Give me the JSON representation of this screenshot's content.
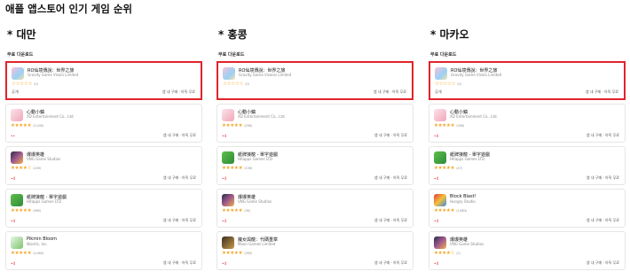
{
  "page_title": "애플 앱스토어 인기 게임 순위",
  "columns": [
    {
      "region": "* 대만",
      "section": "무료 다운로드",
      "apps": [
        {
          "name": "RO仙境傳說：世界之旅",
          "developer": "Gravity Game Vision Limited",
          "stars": 0,
          "rating_count": "(0)",
          "price": "공개",
          "iap": "앱 내 구매 · 아직 무료",
          "icon": "ro-icon",
          "highlight": true
        },
        {
          "name": "心動小鎮",
          "developer": "XD Entertainment Co., Ltd.",
          "stars": 5,
          "rating_count": "(1,049)",
          "price": "••",
          "iap": "앱 내 구매 · 아직 무료",
          "icon": "xd-town-icon",
          "highlight": false
        },
        {
          "name": "爆爆英雄",
          "developer": "VNG Game Studios",
          "stars": 4,
          "rating_count": "(249)",
          "price": "•4",
          "iap": "앱 내 구매 · 아직 무료",
          "icon": "hero-icon",
          "highlight": false
        },
        {
          "name": "紙牌接龍 - 單字遊戲",
          "developer": "Hitapps Games LTD",
          "stars": 5,
          "rating_count": "(965)",
          "price": "•4",
          "iap": "앱 내 구매 · 아직 무료",
          "icon": "solitaire-icon",
          "highlight": false
        },
        {
          "name": "Pikmin Bloom",
          "developer": "Niantic, Inc.",
          "stars": 5,
          "rating_count": "(4,484)",
          "price": "•4",
          "iap": "앱 내 구매 · 아직 무료",
          "icon": "pikmin-icon",
          "highlight": false
        }
      ]
    },
    {
      "region": "* 홍콩",
      "section": "무료 다운로드",
      "apps": [
        {
          "name": "RO仙境傳說：世界之旅",
          "developer": "Gravity Game Visions Limited",
          "stars": 0,
          "rating_count": "(0)",
          "price": "",
          "iap": "앱 내 구매 · 아직 무료",
          "icon": "ro-icon",
          "highlight": true
        },
        {
          "name": "心動小鎮",
          "developer": "XD Entertainment Co., Ltd.",
          "stars": 5,
          "rating_count": "(296)",
          "price": "•4",
          "iap": "앱 내 구매 · 아직 무료",
          "icon": "xd-town-icon",
          "highlight": false
        },
        {
          "name": "紙牌接龍 - 單字遊戲",
          "developer": "Hitapps Games LTD",
          "stars": 5,
          "rating_count": "(158)",
          "price": "•4",
          "iap": "앱 내 구매 · 아직 무료",
          "icon": "solitaire-icon",
          "highlight": false
        },
        {
          "name": "爆爆英雄",
          "developer": "VNG Game Studios",
          "stars": 5,
          "rating_count": "(36)",
          "price": "•4",
          "iap": "앱 내 구매 · 아직 무료",
          "icon": "hero-icon",
          "highlight": false
        },
        {
          "name": "魔女與龍：代碼重章",
          "developer": "Moon Games Limited",
          "stars": 5,
          "rating_count": "(265)",
          "price": "•4",
          "iap": "앱 내 구매 · 아직 무료",
          "icon": "witch-icon",
          "highlight": false
        }
      ]
    },
    {
      "region": "* 마카오",
      "section": "무료 다운로드",
      "apps": [
        {
          "name": "RO仙境傳說：世界之旅",
          "developer": "Gravity Game Vision Limited",
          "stars": 0,
          "rating_count": "(0)",
          "price": "공개",
          "iap": "앱 내 구매 · 아직 무료",
          "icon": "ro-icon",
          "highlight": true
        },
        {
          "name": "心動小鎮",
          "developer": "XD Entertainment Co., Ltd.",
          "stars": 5,
          "rating_count": "(186)",
          "price": "•4",
          "iap": "앱 내 구매 · 아직 무료",
          "icon": "xd-town-icon",
          "highlight": false
        },
        {
          "name": "紙牌接龍 - 單字遊戲",
          "developer": "Hitapps Games LTD",
          "stars": 5,
          "rating_count": "(47)",
          "price": "•4",
          "iap": "앱 내 구매 · 아직 무료",
          "icon": "solitaire-icon",
          "highlight": false
        },
        {
          "name": "Block Blast!",
          "developer": "Hungry Studio",
          "stars": 5,
          "rating_count": "(1,684)",
          "price": "•4",
          "iap": "앱 내 구매 · 아직 무료",
          "icon": "blockblast-icon",
          "highlight": false
        },
        {
          "name": "爆爆英雄",
          "developer": "VNG Game Studios",
          "stars": 4,
          "rating_count": "(2)",
          "price": "•4",
          "iap": "앱 내 구매 · 아직 무료",
          "icon": "hero-icon",
          "highlight": false
        }
      ]
    }
  ],
  "colors": {
    "highlight": "#e0242b",
    "star": "#f5a623",
    "price": "#e0242b"
  }
}
